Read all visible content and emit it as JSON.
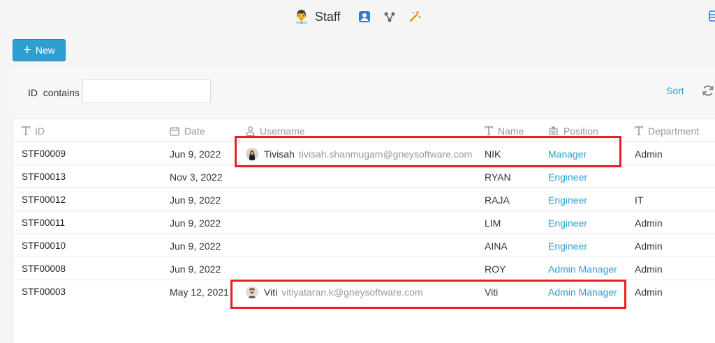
{
  "header": {
    "title": "Staff",
    "title_emoji": "👨‍💼",
    "icons": [
      "person-card-icon",
      "flow-icon",
      "magic-wand-icon"
    ]
  },
  "toolbar": {
    "new_label": "New"
  },
  "filter": {
    "label": "ID  contains",
    "value": "",
    "placeholder": "",
    "sort_label": "Sort"
  },
  "table": {
    "columns": [
      {
        "key": "id",
        "label": "ID",
        "icon": "text-type-icon"
      },
      {
        "key": "date",
        "label": "Date",
        "icon": "calendar-icon"
      },
      {
        "key": "username",
        "label": "Username",
        "icon": "user-icon"
      },
      {
        "key": "name",
        "label": "Name",
        "icon": "text-type-icon"
      },
      {
        "key": "position",
        "label": "Position",
        "icon": "building-icon"
      },
      {
        "key": "department",
        "label": "Department",
        "icon": "text-type-icon"
      }
    ],
    "rows": [
      {
        "id": "STF00009",
        "date": "Jun 9, 2022",
        "user_name": "Tivisah",
        "user_email": "tivisah.shanmugam@gneysoftware.com",
        "name": "NIK",
        "position": "Manager",
        "department": "Admin"
      },
      {
        "id": "STF00013",
        "date": "Nov 3, 2022",
        "user_name": "",
        "user_email": "",
        "name": "RYAN",
        "position": "Engineer",
        "department": ""
      },
      {
        "id": "STF00012",
        "date": "Jun 9, 2022",
        "user_name": "",
        "user_email": "",
        "name": "RAJA",
        "position": "Engineer",
        "department": "IT"
      },
      {
        "id": "STF00011",
        "date": "Jun 9, 2022",
        "user_name": "",
        "user_email": "",
        "name": "LIM",
        "position": "Engineer",
        "department": "Admin"
      },
      {
        "id": "STF00010",
        "date": "Jun 9, 2022",
        "user_name": "",
        "user_email": "",
        "name": "AINA",
        "position": "Engineer",
        "department": "Admin"
      },
      {
        "id": "STF00008",
        "date": "Jun 9, 2022",
        "user_name": "",
        "user_email": "",
        "name": "ROY",
        "position": "Admin Manager",
        "department": "Admin"
      },
      {
        "id": "STF00003",
        "date": "May 12, 2021",
        "user_name": "Viti",
        "user_email": "vitiyataran.k@gneysoftware.com",
        "name": "Viti",
        "position": "Admin Manager",
        "department": "Admin"
      }
    ]
  },
  "colors": {
    "accent": "#2e9fd1",
    "highlight": "#ee1c24"
  }
}
